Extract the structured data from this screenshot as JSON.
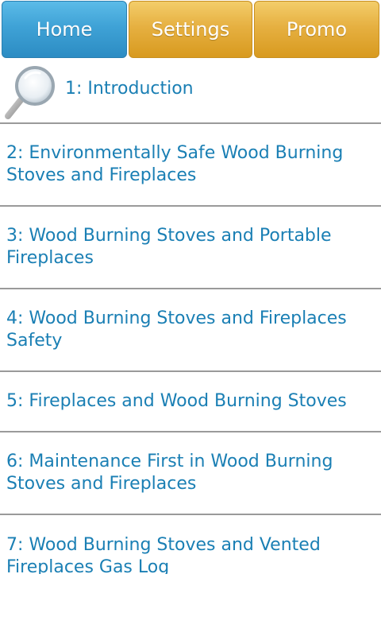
{
  "tabs": [
    {
      "label": "Home",
      "active": true
    },
    {
      "label": "Settings",
      "active": false
    },
    {
      "label": "Promo",
      "active": false
    }
  ],
  "items": [
    {
      "label": "1: Introduction",
      "icon": "magnifier-icon"
    },
    {
      "label": "2: Environmentally Safe Wood Burning Stoves and Fireplaces"
    },
    {
      "label": "3: Wood Burning Stoves and Portable Fireplaces"
    },
    {
      "label": "4: Wood Burning Stoves and Fireplaces Safety"
    },
    {
      "label": "5: Fireplaces and Wood Burning Stoves"
    },
    {
      "label": "6: Maintenance First in Wood Burning Stoves and Fireplaces"
    },
    {
      "label": "7: Wood Burning Stoves and Vented Fireplaces Gas Log"
    }
  ],
  "colors": {
    "home_tab": "#3fa2d6",
    "other_tabs": "#e6b041",
    "item_text": "#1a7fb4",
    "divider": "#9a9a9a"
  }
}
